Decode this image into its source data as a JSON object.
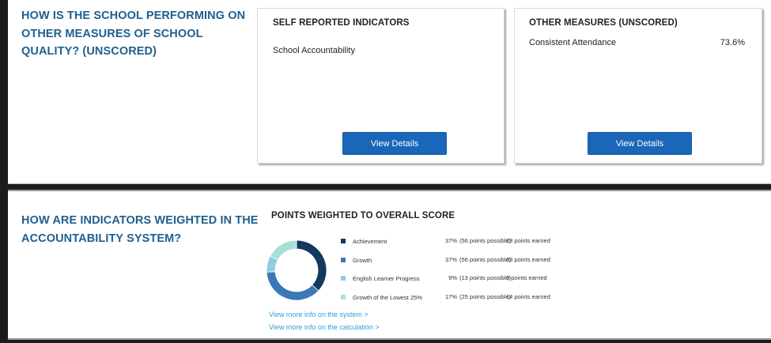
{
  "section_other_measures": {
    "heading": "HOW IS THE SCHOOL PERFORMING ON OTHER MEASURES OF SCHOOL QUALITY? (UNSCORED)",
    "self_reported": {
      "title": "SELF REPORTED INDICATORS",
      "item": "School Accountability",
      "button": "View Details"
    },
    "other_measures": {
      "title": "OTHER MEASURES (UNSCORED)",
      "item_label": "Consistent Attendance",
      "item_value": "73.6%",
      "button": "View Details"
    }
  },
  "section_weighting": {
    "heading": "HOW ARE INDICATORS WEIGHTED IN THE ACCOUNTABILITY SYSTEM?",
    "points_title": "POINTS WEIGHTED TO OVERALL SCORE",
    "legend": [
      {
        "label": "Achievement",
        "pct": "37%",
        "possible": "(56 points possible)",
        "earned": "23 points earned"
      },
      {
        "label": "Growth",
        "pct": "37%",
        "possible": "(56 points possible)",
        "earned": "33 points earned"
      },
      {
        "label": "English Learner Progress",
        "pct": "9%",
        "possible": "(13 points possible)",
        "earned": "3 points earned"
      },
      {
        "label": "Growth of the Lowest 25%",
        "pct": "17%",
        "possible": "(25 points possible)",
        "earned": "14 points earned"
      }
    ],
    "links": {
      "system": "View more info on the system >",
      "calculation": "View more info on the calculation >"
    }
  },
  "chart_data": {
    "type": "pie",
    "categories": [
      "Achievement",
      "Growth",
      "English Learner Progress",
      "Growth of the Lowest 25%"
    ],
    "values": [
      37,
      37,
      9,
      17
    ],
    "colors": [
      "#14385e",
      "#3a78b8",
      "#8fcde6",
      "#a5dfd8"
    ],
    "title": "POINTS WEIGHTED TO OVERALL SCORE"
  }
}
